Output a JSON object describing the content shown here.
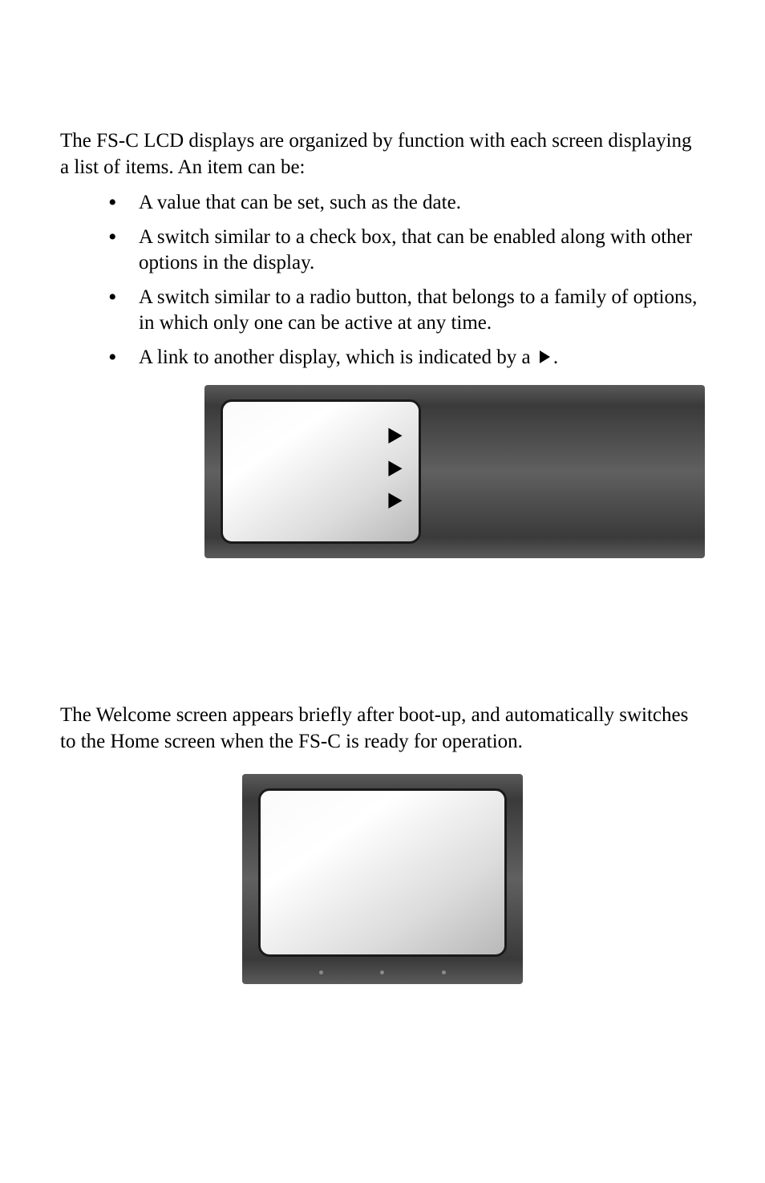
{
  "intro": "The FS-C LCD displays are organized by function with each screen displaying a list of items. An item can be:",
  "bullets": [
    "A value that can be set, such as the date.",
    "A switch similar to a check box,  that can be enabled along with other options in the display.",
    "A switch similar to a radio button, that belongs to a family of options, in which only one can be active at any time.",
    "A link to another display, which is indicated by a "
  ],
  "bullet4_suffix": ".",
  "welcome_paragraph": "The Welcome screen appears briefly after boot-up, and automatically switches to the Home screen when the FS-C is ready for operation."
}
